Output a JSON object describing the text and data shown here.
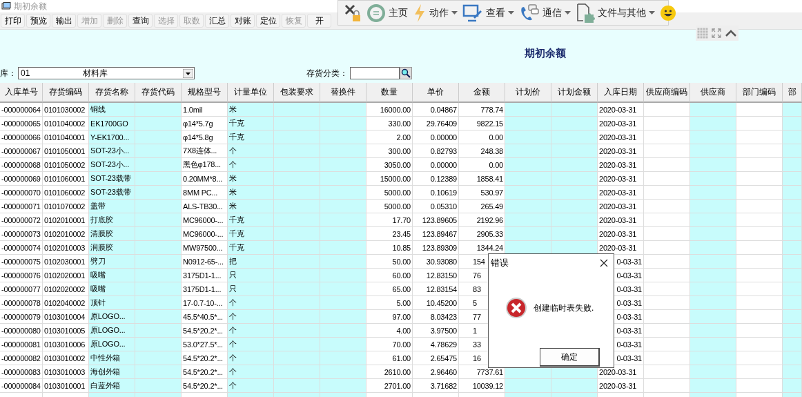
{
  "window": {
    "title": "期初余额"
  },
  "toolbar": [
    {
      "label": "打印",
      "disabled": false
    },
    {
      "label": "预览",
      "disabled": false
    },
    {
      "label": "输出",
      "disabled": false
    },
    {
      "label": "增加",
      "disabled": true
    },
    {
      "label": "删除",
      "disabled": true
    },
    {
      "label": "查询",
      "disabled": false
    },
    {
      "label": "选择",
      "disabled": true
    },
    {
      "label": "取数",
      "disabled": true
    },
    {
      "label": "汇总",
      "disabled": false
    },
    {
      "label": "对账",
      "disabled": false
    },
    {
      "label": "定位",
      "disabled": false
    },
    {
      "label": "恢复",
      "disabled": true
    },
    {
      "label": "开",
      "disabled": false
    }
  ],
  "remote_bar": {
    "items": [
      {
        "kind": "disconnect"
      },
      {
        "kind": "home",
        "label": "主页"
      },
      {
        "kind": "action",
        "label": "动作",
        "menu": true
      },
      {
        "kind": "view",
        "label": "查看",
        "menu": true
      },
      {
        "kind": "chat",
        "label": "通信",
        "menu": true
      },
      {
        "kind": "file",
        "label": "文件与其他",
        "menu": true
      },
      {
        "kind": "smiley"
      }
    ]
  },
  "report": {
    "title": "期初余额",
    "warehouse_label": "库：",
    "warehouse_code": "01",
    "warehouse_name": "材料库",
    "category_label": "存货分类："
  },
  "table": {
    "columns": [
      {
        "label": "入库单号",
        "kind": "text",
        "editable": false
      },
      {
        "label": "存货编码",
        "kind": "text",
        "editable": false
      },
      {
        "label": "存货名称",
        "kind": "text",
        "editable": true
      },
      {
        "label": "存货代码",
        "editable": true
      },
      {
        "label": "规格型号",
        "kind": "text",
        "editable": false
      },
      {
        "label": "计量单位",
        "kind": "text",
        "editable": true
      },
      {
        "label": "包装要求",
        "editable": true
      },
      {
        "label": "替换件",
        "editable": true
      },
      {
        "label": "数量",
        "kind": "number",
        "editable": false
      },
      {
        "label": "单价",
        "kind": "number",
        "editable": false
      },
      {
        "label": "金额",
        "kind": "number",
        "editable": false
      },
      {
        "label": "计划价",
        "editable": true
      },
      {
        "label": "计划金额",
        "editable": true
      },
      {
        "label": "入库日期",
        "kind": "text",
        "editable": false
      },
      {
        "label": "供应商编码",
        "editable": false
      },
      {
        "label": "供应商",
        "editable": true
      },
      {
        "label": "部门编码",
        "editable": false
      },
      {
        "label": "部",
        "editable": true
      }
    ],
    "rows": [
      [
        "-000000064",
        "0101030002",
        "铜线",
        null,
        "1.0mil",
        "米",
        null,
        null,
        "16000.00",
        "0.04867",
        "778.74",
        null,
        null,
        "2020-03-31",
        null,
        null,
        null,
        null
      ],
      [
        "-000000065",
        "0101040002",
        "EK1700GO",
        null,
        "φ14*5.7g",
        "千克",
        null,
        null,
        "330.00",
        "29.76409",
        "9822.15",
        null,
        null,
        "2020-03-31",
        null,
        null,
        null,
        null
      ],
      [
        "-000000066",
        "0101040001",
        "Y-EK1700...",
        null,
        "φ14*5.8g",
        "千克",
        null,
        null,
        "2.00",
        "0.00000",
        "0.00",
        null,
        null,
        "2020-03-31",
        null,
        null,
        null,
        null
      ],
      [
        "-000000067",
        "0101050001",
        "SOT-23小...",
        null,
        "7X8连体...",
        "个",
        null,
        null,
        "300.00",
        "0.82793",
        "248.38",
        null,
        null,
        "2020-03-31",
        null,
        null,
        null,
        null
      ],
      [
        "-000000068",
        "0101050002",
        "SOT-23小...",
        null,
        "黑色φ178...",
        "个",
        null,
        null,
        "3050.00",
        "0.00000",
        "0.00",
        null,
        null,
        "2020-03-31",
        null,
        null,
        null,
        null
      ],
      [
        "-000000069",
        "0101060001",
        "SOT-23载带",
        null,
        "0.20MM*8...",
        "米",
        null,
        null,
        "15000.00",
        "0.12389",
        "1858.41",
        null,
        null,
        "2020-03-31",
        null,
        null,
        null,
        null
      ],
      [
        "-000000070",
        "0101060002",
        "SOT-23载带",
        null,
        "8MM PC...",
        "米",
        null,
        null,
        "5000.00",
        "0.10619",
        "530.97",
        null,
        null,
        "2020-03-31",
        null,
        null,
        null,
        null
      ],
      [
        "-000000071",
        "0101070002",
        "盖带",
        null,
        "ALS-TB30...",
        "米",
        null,
        null,
        "5000.00",
        "0.05310",
        "265.49",
        null,
        null,
        "2020-03-31",
        null,
        null,
        null,
        null
      ],
      [
        "-000000072",
        "0102010001",
        "打底胶",
        null,
        "MC96000-...",
        "千克",
        null,
        null,
        "17.70",
        "123.89605",
        "2192.96",
        null,
        null,
        "2020-03-31",
        null,
        null,
        null,
        null
      ],
      [
        "-000000073",
        "0102010002",
        "清膜胶",
        null,
        "MC96000-...",
        "千克",
        null,
        null,
        "23.45",
        "123.89467",
        "2905.33",
        null,
        null,
        "2020-03-31",
        null,
        null,
        null,
        null
      ],
      [
        "-000000074",
        "0102010003",
        "润膜胶",
        null,
        "MW97500...",
        "千克",
        null,
        null,
        "10.85",
        "123.89309",
        "1344.24",
        null,
        null,
        "2020-03-31",
        null,
        null,
        null,
        null
      ],
      [
        "-000000075",
        "0102030001",
        "劈刀",
        null,
        "N0912-65-...",
        "把",
        null,
        null,
        "50.00",
        "30.93080",
        {
          "text": "154",
          "clipped": true
        },
        null,
        null,
        {
          "text": "0-03-31",
          "clipped": true
        },
        null,
        null,
        null,
        null
      ],
      [
        "-000000076",
        "0102020001",
        "吸嘴",
        null,
        "3175D1-1...",
        "只",
        null,
        null,
        "60.00",
        "12.83150",
        {
          "text": "76",
          "clipped": true
        },
        null,
        null,
        {
          "text": "0-03-31",
          "clipped": true
        },
        null,
        null,
        null,
        null
      ],
      [
        "-000000077",
        "0102020002",
        "吸嘴",
        null,
        "3175D1-1...",
        "只",
        null,
        null,
        "65.00",
        "12.83154",
        {
          "text": "83",
          "clipped": true
        },
        null,
        null,
        {
          "text": "0-03-31",
          "clipped": true
        },
        null,
        null,
        null,
        null
      ],
      [
        "-000000078",
        "0102040002",
        "顶针",
        null,
        "17-0.7-10-...",
        "个",
        null,
        null,
        "5.00",
        "10.45200",
        {
          "text": "5",
          "clipped": true
        },
        null,
        null,
        {
          "text": "0-03-31",
          "clipped": true
        },
        null,
        null,
        null,
        null
      ],
      [
        "-000000079",
        "0103010004",
        "原LOGO...",
        null,
        "45.5*40.5*...",
        "个",
        null,
        null,
        "97.00",
        "8.03423",
        {
          "text": "77",
          "clipped": true
        },
        null,
        null,
        {
          "text": "0-03-31",
          "clipped": true
        },
        null,
        null,
        null,
        null
      ],
      [
        "-000000080",
        "0103010005",
        "原LOGO...",
        null,
        "54.5*20.2*...",
        "个",
        null,
        null,
        "4.00",
        "3.97500",
        {
          "text": "1",
          "clipped": true
        },
        null,
        null,
        {
          "text": "0-03-31",
          "clipped": true
        },
        null,
        null,
        null,
        null
      ],
      [
        "-000000081",
        "0103010006",
        "原LOGO...",
        null,
        "53.0*27.5*...",
        "个",
        null,
        null,
        "70.00",
        "4.78629",
        {
          "text": "33",
          "clipped": true
        },
        null,
        null,
        {
          "text": "0-03-31",
          "clipped": true
        },
        null,
        null,
        null,
        null
      ],
      [
        "-000000082",
        "0103010002",
        "中性外箱",
        null,
        "54.5*20.2*...",
        "个",
        null,
        null,
        "61.00",
        "2.65475",
        {
          "text": "16",
          "clipped": true
        },
        null,
        null,
        {
          "text": "0-03-31",
          "clipped": true
        },
        null,
        null,
        null,
        null
      ],
      [
        "-000000083",
        "0103010003",
        "海创外箱",
        null,
        "54.5*20.2*...",
        "个",
        null,
        null,
        "2610.00",
        "2.96460",
        "7737.61",
        null,
        null,
        "2020-03-31",
        null,
        null,
        null,
        null
      ],
      [
        "-000000084",
        "0103010001",
        "白蓝外箱",
        null,
        "54.5*20.2*...",
        "个",
        null,
        null,
        "2701.00",
        "3.71682",
        "10039.12",
        null,
        null,
        "2020-03-31",
        null,
        null,
        null,
        null
      ]
    ]
  },
  "dialog": {
    "title": "错误",
    "kind": "error",
    "message": "创建临时表失败.",
    "button": "确定"
  }
}
